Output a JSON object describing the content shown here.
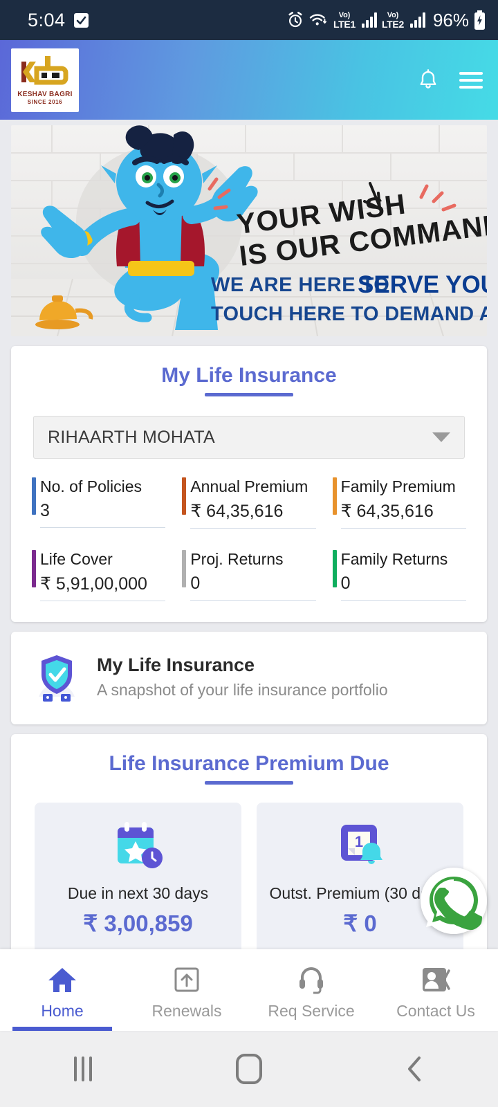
{
  "status_bar": {
    "time": "5:04",
    "icons": [
      "checkbox-icon",
      "alarm-icon",
      "wifi-icon"
    ],
    "sim1_label_top": "Vo)",
    "sim1_label": "LTE1",
    "sim2_label_top": "Vo)",
    "sim2_label": "LTE2",
    "battery_percent": "96%"
  },
  "header": {
    "logo_line1": "KESHAV BAGRI",
    "logo_line2": "SINCE 2016",
    "logo_mark": "KB",
    "bell_label": "notifications",
    "menu_label": "menu"
  },
  "banner": {
    "headline_line1": "YOUR WISH",
    "headline_line2": "IS OUR COMMAND",
    "sub_plain": "WE ARE HERE TO ",
    "sub_bold": "SERVE YOU",
    "cta": "TOUCH HERE TO DEMAND A SERVICE"
  },
  "life_insurance": {
    "title": "My Life Insurance",
    "selected_member": "RIHAARTH MOHATA",
    "stats": [
      {
        "label": "No. of Policies",
        "value": "3",
        "accent": "#3f72c0"
      },
      {
        "label": "Annual Premium",
        "value": "₹ 64,35,616",
        "accent": "#c4551f"
      },
      {
        "label": "Family Premium",
        "value": "₹ 64,35,616",
        "accent": "#e8922c"
      },
      {
        "label": "Life Cover",
        "value": "₹ 5,91,00,000",
        "accent": "#7b2a8e"
      },
      {
        "label": "Proj. Returns",
        "value": "0",
        "accent": "#b0b0b0"
      },
      {
        "label": "Family Returns",
        "value": "0",
        "accent": "#0fae5e"
      }
    ]
  },
  "snapshot": {
    "icon": "shield-check-icon",
    "title": "My Life Insurance",
    "subtitle": "A snapshot of your life insurance portfolio"
  },
  "premium_due": {
    "title": "Life Insurance Premium Due",
    "tiles": [
      {
        "icon": "calendar-star-icon",
        "label": "Due in next 30 days",
        "amount": "₹ 3,00,859"
      },
      {
        "icon": "reminder-bell-icon",
        "label": "Outst. Premium (30 days)",
        "amount": "₹ 0"
      }
    ]
  },
  "whatsapp_fab": {
    "label": "WhatsApp",
    "color": "#3aa33f"
  },
  "bottom_nav": {
    "items": [
      {
        "label": "Home",
        "icon": "home-icon",
        "active": true
      },
      {
        "label": "Renewals",
        "icon": "upload-icon",
        "active": false
      },
      {
        "label": "Req Service",
        "icon": "headset-icon",
        "active": false
      },
      {
        "label": "Contact Us",
        "icon": "contacts-icon",
        "active": false
      }
    ]
  },
  "android_nav": {
    "recents": "recents",
    "home": "home",
    "back": "back"
  }
}
